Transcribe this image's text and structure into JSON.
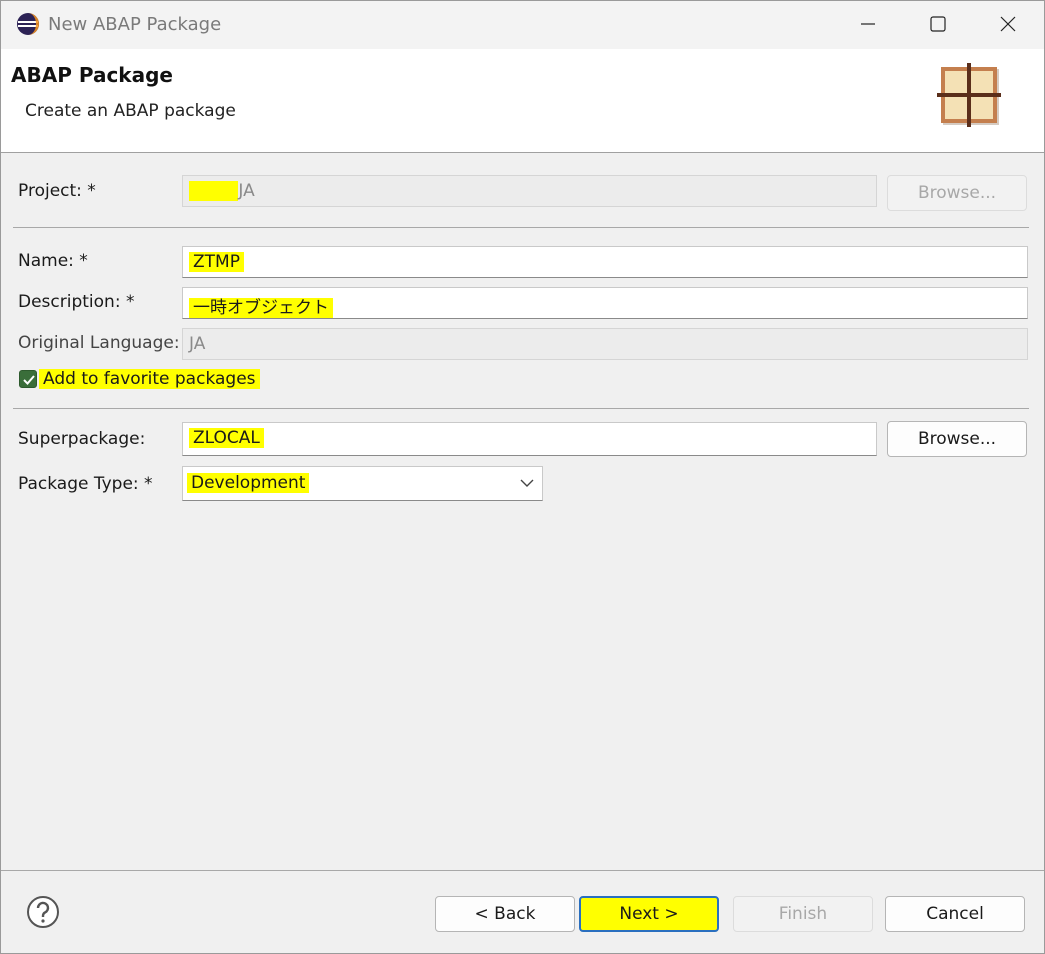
{
  "window": {
    "title": "New ABAP Package"
  },
  "header": {
    "title": "ABAP Package",
    "description": "Create an ABAP package"
  },
  "fields": {
    "project": {
      "label": "Project: *",
      "mnemonic": "P",
      "value": "JA",
      "browse_label": "Browse..."
    },
    "name": {
      "label": "Name: *",
      "value": "ZTMP"
    },
    "description": {
      "label": "Description: *",
      "value": "一時オブジェクト"
    },
    "original_language": {
      "label": "Original Language:",
      "value": "JA"
    },
    "favorite": {
      "label": "Add to favorite packages",
      "checked": true
    },
    "superpackage": {
      "label": "Superpackage:",
      "value": "ZLOCAL",
      "browse_label": "Browse..."
    },
    "package_type": {
      "label": "Package Type: *",
      "value": "Development"
    }
  },
  "footer": {
    "back_label": "< Back",
    "next_label": "Next >",
    "finish_label": "Finish",
    "cancel_label": "Cancel"
  },
  "icons": {
    "app": "eclipse-icon",
    "header": "package-icon",
    "help": "help-icon",
    "dropdown": "chevron-down-icon"
  },
  "colors": {
    "highlight": "#ffff00",
    "checkbox": "#3a6e3a"
  }
}
